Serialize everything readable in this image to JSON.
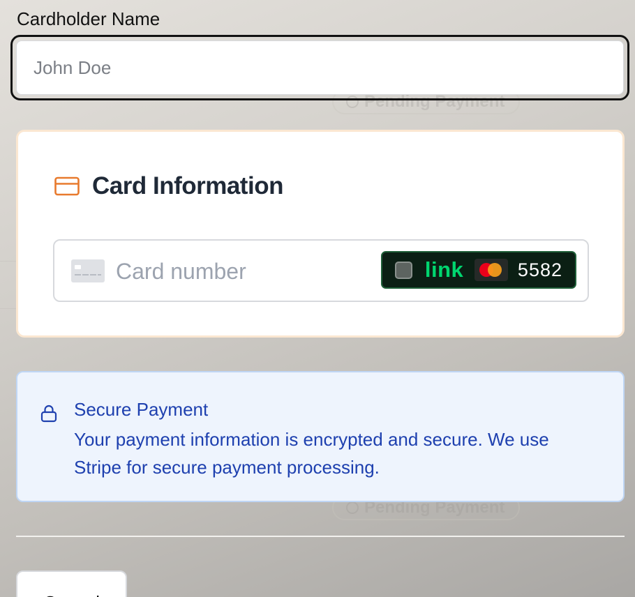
{
  "form": {
    "cardholder_label": "Cardholder Name",
    "cardholder_placeholder": "John Doe",
    "cardholder_value": ""
  },
  "card_info": {
    "heading": "Card Information",
    "heading_icon": "credit-card-icon",
    "card_number_placeholder": "Card number",
    "card_number_icon": "generic-card-icon",
    "link": {
      "brand": "link",
      "card_brand_icon": "mastercard-icon",
      "last4": "5582"
    }
  },
  "notice": {
    "icon": "lock-icon",
    "title": "Secure Payment",
    "description": "Your payment information is encrypted and secure. We use Stripe for secure payment processing."
  },
  "actions": {
    "cancel_label": "Cancel"
  },
  "background": {
    "status_label": "Pending Payment"
  },
  "colors": {
    "accent_orange": "#e87a2d",
    "notice_text": "#1e40af",
    "notice_bg": "#eef4fd",
    "link_green": "#00d66f"
  }
}
